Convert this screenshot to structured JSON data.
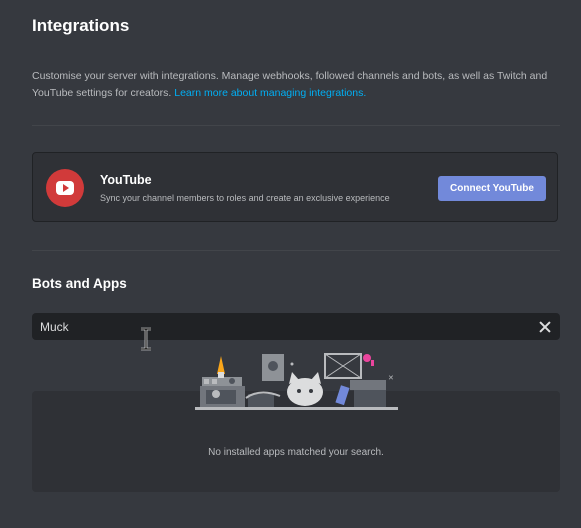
{
  "page": {
    "title": "Integrations",
    "description": "Customise your server with integrations. Manage webhooks, followed channels and bots, as well as Twitch and YouTube settings for creators.",
    "learn_more_link": "Learn more about managing integrations."
  },
  "youtube": {
    "icon": "youtube-icon",
    "title": "YouTube",
    "description": "Sync your channel members to roles and create an exclusive experience",
    "connect_label": "Connect YouTube"
  },
  "bots_and_apps": {
    "heading": "Bots and Apps",
    "search_value": "Muck",
    "clear_icon": "close-icon",
    "empty_message": "No installed apps matched your search."
  },
  "colors": {
    "background": "#36393f",
    "card": "#2f3136",
    "accent": "#7289da",
    "link": "#00aff4",
    "youtube_red": "#d13a3a"
  }
}
